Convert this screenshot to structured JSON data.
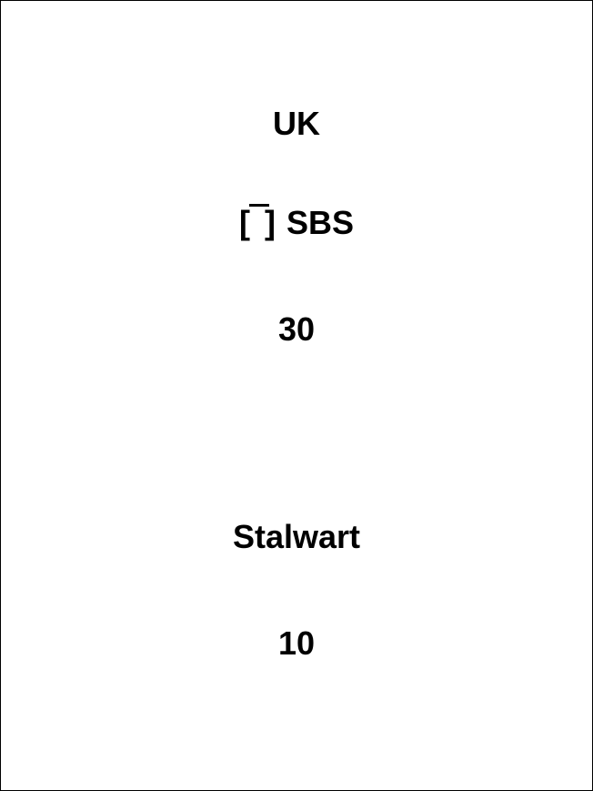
{
  "card": {
    "country": "UK",
    "unit_symbol": {
      "open": "[",
      "close": "]",
      "icon": "unit-type-symbol-icon"
    },
    "unit_name": "SBS",
    "value_1": "30",
    "name": "Stalwart",
    "value_2": "10",
    "border_color": "#000000",
    "text_color": "#000000",
    "background_color": "#ffffff"
  }
}
